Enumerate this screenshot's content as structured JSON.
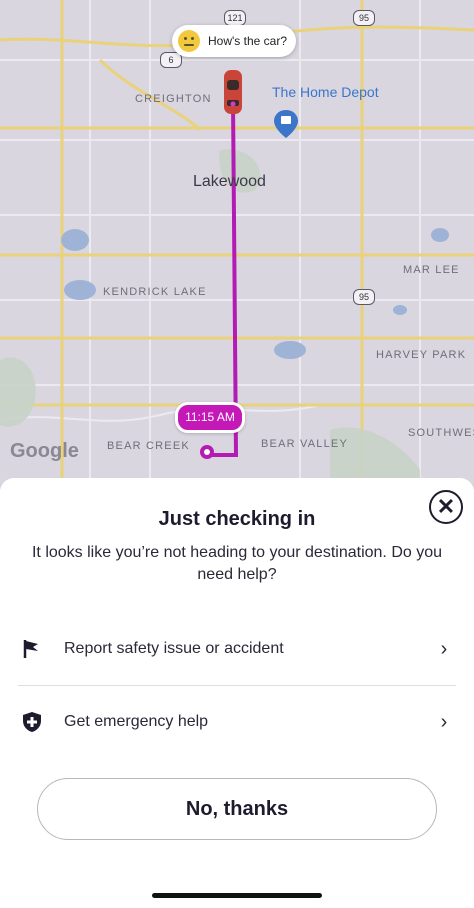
{
  "map": {
    "labels": {
      "creighton": "CREIGHTON",
      "kendrick_lake": "KENDRICK LAKE",
      "mar_lee": "MAR LEE",
      "harvey_park": "HARVEY PARK",
      "bear_creek": "BEAR CREEK",
      "bear_valley": "BEAR VALLEY",
      "southwest": "SOUTHWES"
    },
    "city": "Lakewood",
    "poi": "The Home Depot",
    "shields": {
      "r121": "121",
      "r95_top": "95",
      "r6": "6",
      "r95_mid": "95"
    },
    "attribution": "Google",
    "route_color": "#b31bb3"
  },
  "car_bubble": {
    "text": "How's the car?",
    "icon": "smiley-face-icon"
  },
  "eta_pill": {
    "text": "11:15 AM"
  },
  "sheet": {
    "title": "Just checking in",
    "message": "It looks like you’re not heading to your destination. Do you need help?",
    "close_icon": "close-icon",
    "options": [
      {
        "label": "Report safety issue or accident",
        "icon": "flag-icon"
      },
      {
        "label": "Get emergency help",
        "icon": "shield-plus-icon"
      }
    ],
    "dismiss_button": "No, thanks"
  }
}
